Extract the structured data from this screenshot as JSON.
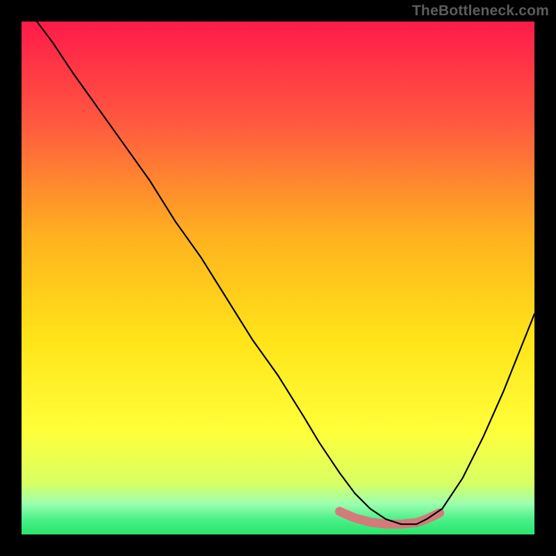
{
  "watermark": "TheBottleneck.com",
  "colors": {
    "top": "#ff1a4a",
    "upper_mid": "#ff7a3a",
    "mid": "#ffd21a",
    "lower_mid": "#ffff3a",
    "low": "#d8ff63",
    "bottom_band_top": "#7cff8a",
    "bottom_band_bot": "#27e56b",
    "curve": "#000000",
    "highlight": "#d47a7a",
    "frame": "#000000"
  },
  "chart_data": {
    "type": "line",
    "title": "",
    "xlabel": "",
    "ylabel": "",
    "xlim": [
      0,
      100
    ],
    "ylim": [
      0,
      100
    ],
    "series": [
      {
        "name": "bottleneck-curve",
        "x": [
          3,
          6,
          10,
          15,
          20,
          25,
          30,
          35,
          40,
          45,
          50,
          55,
          58,
          60,
          62,
          65,
          68,
          71,
          74,
          77,
          79,
          82,
          86,
          90,
          94,
          98,
          100
        ],
        "y": [
          100,
          96,
          90,
          83,
          76,
          69,
          61,
          54,
          46,
          38,
          31,
          23,
          18,
          15,
          12,
          8,
          5,
          3,
          2,
          2,
          3,
          5,
          11,
          19,
          28,
          38,
          43
        ],
        "comment": "y is distance from the bottom (0=bottom green, 100=top); curve descends from top-left, bottoms ~x 71-77, rises toward right edge"
      },
      {
        "name": "optimal-zone-highlight",
        "x": [
          62,
          65,
          68,
          71,
          74,
          77,
          79,
          81.5
        ],
        "y": [
          4.5,
          3.2,
          2.4,
          2.0,
          2.0,
          2.3,
          3.0,
          4.2
        ],
        "comment": "thicker salmon overlay on the valley floor"
      }
    ],
    "gradient_stops_pct_from_top": [
      {
        "p": 0,
        "c": "#ff1a4a"
      },
      {
        "p": 20,
        "c": "#ff5a3f"
      },
      {
        "p": 42,
        "c": "#ffb21f"
      },
      {
        "p": 62,
        "c": "#ffe419"
      },
      {
        "p": 80,
        "c": "#ffff3a"
      },
      {
        "p": 90,
        "c": "#d8ff63"
      },
      {
        "p": 94,
        "c": "#9cffb0"
      },
      {
        "p": 97,
        "c": "#4cf08a"
      },
      {
        "p": 100,
        "c": "#27e56b"
      }
    ]
  }
}
